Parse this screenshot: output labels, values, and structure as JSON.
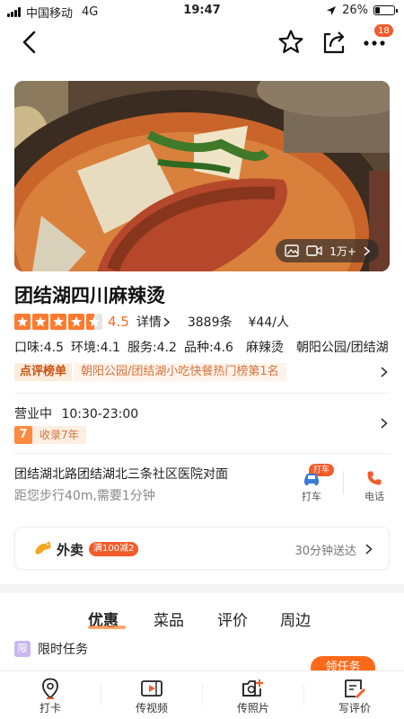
{
  "status_bar": {
    "carrier": "中国移动",
    "network": "4G",
    "time": "19:47",
    "battery": "26%",
    "battery_level": 0.26
  },
  "nav": {
    "badge_count": "18"
  },
  "hero": {
    "photo_count": "1万+"
  },
  "shop": {
    "name": "团结湖四川麻辣烫",
    "score": "4.5",
    "rating_value": 4.5,
    "detail_label": "详情",
    "reviews": "3889条",
    "price": "¥44/人",
    "metrics": [
      "口味:4.5",
      "环境:4.1",
      "服务:4.2",
      "品种:4.6",
      "麻辣烫",
      "朝阳公园/团结湖"
    ],
    "rank_tag": "点评榜单",
    "rank_text": "朝阳公园/团结湖小吃快餐热门榜第1名"
  },
  "hours": {
    "status": "营业中",
    "time": "10:30-23:00",
    "years_num": "7",
    "years_text": "收录7年"
  },
  "address": {
    "text": "团结湖北路团结湖北三条社区医院对面",
    "walk": "距您步行40m,需要1分钟"
  },
  "actions": {
    "taxi_badge": "打车",
    "taxi": "打车",
    "phone": "电话"
  },
  "delivery": {
    "title": "外卖",
    "promo": "满100减2",
    "eta": "30分钟送达"
  },
  "tabs": [
    "优惠",
    "菜品",
    "评价",
    "周边"
  ],
  "task": {
    "icon": "限",
    "title": "限时任务",
    "button": "领任务"
  },
  "bottom_bar": [
    "打卡",
    "传视频",
    "传照片",
    "写评价"
  ],
  "colors": {
    "accent": "#ff6a1a",
    "badge": "#f25c2a",
    "taxi_blue": "#3c7bd6"
  }
}
